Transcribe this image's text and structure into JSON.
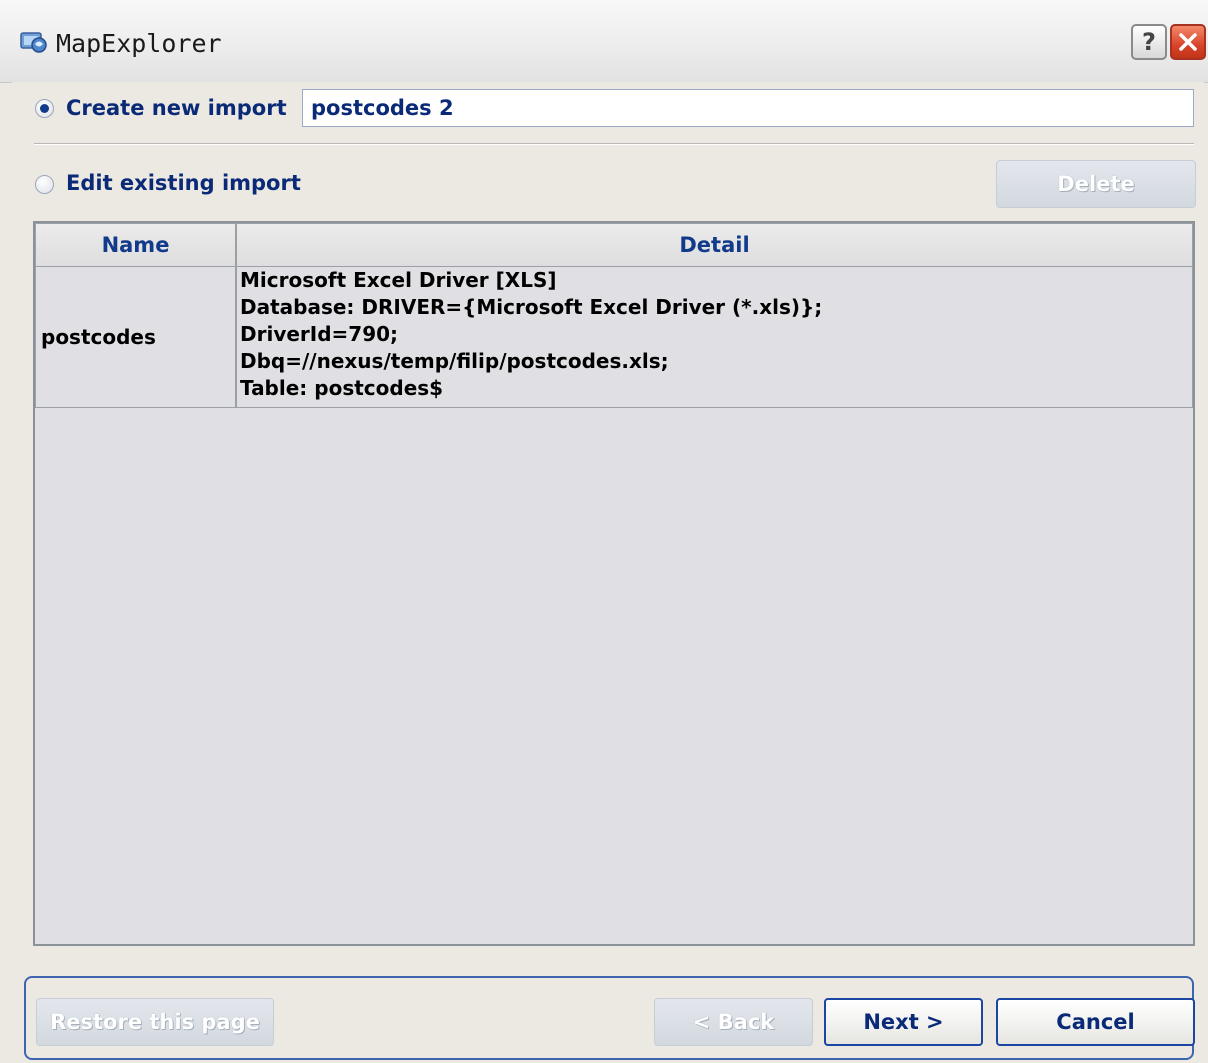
{
  "window": {
    "title": "MapExplorer",
    "help_label": "?"
  },
  "create_new": {
    "label": "Create new import",
    "selected": true,
    "name_value": "postcodes 2"
  },
  "edit_existing": {
    "label": "Edit existing import",
    "selected": false,
    "delete_label": "Delete"
  },
  "grid": {
    "columns": [
      "Name",
      "Detail"
    ],
    "rows": [
      {
        "name": "postcodes",
        "detail": [
          "Microsoft Excel Driver [XLS]",
          "Database: DRIVER={Microsoft Excel Driver (*.xls)};",
          "DriverId=790;",
          "Dbq=//nexus/temp/filip/postcodes.xls;",
          "Table: postcodes$"
        ]
      }
    ]
  },
  "footer": {
    "restore_label": "Restore this page",
    "back_label": "< Back",
    "next_label": "Next >",
    "cancel_label": "Cancel"
  }
}
